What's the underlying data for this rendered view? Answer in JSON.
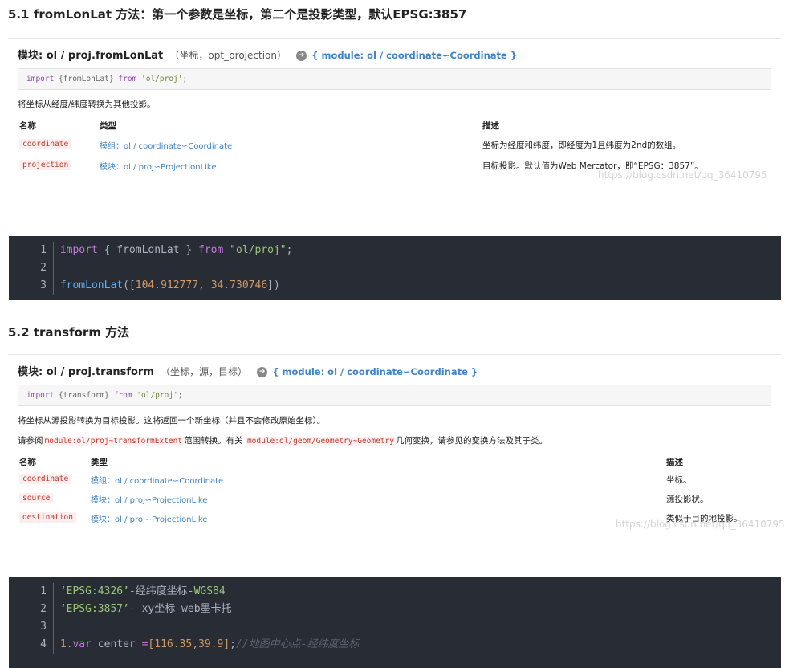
{
  "section1": {
    "heading": "5.1 fromLonLat 方法：第一个参数是坐标，第二个是投影类型，默认EPSG:3857",
    "module_label": "模块: ol / proj.fromLonLat",
    "signature": "（坐标，opt_projection）",
    "link_text": "{ module: ol / coordinate∽Coordinate }",
    "import_code": {
      "kw1": "import",
      "name": " {fromLonLat} ",
      "kw2": "from",
      "str": " 'ol/proj'",
      "end": ";"
    },
    "description": "将坐标从经度/纬度转换为其他投影。",
    "columns": {
      "name": "名称",
      "type": "类型",
      "desc": "描述"
    },
    "params": [
      {
        "name": "coordinate",
        "type": "模组：ol / coordinate∽Coordinate",
        "desc": "坐标为经度和纬度，即经度为1且纬度为2nd的数组。"
      },
      {
        "name": "projection",
        "type": "模块：ol / proj∽ProjectionLike",
        "desc": "目标投影。默认值为Web Mercator，即“EPSG：3857”。"
      }
    ],
    "watermark": "https://blog.csdn.net/qq_36410795"
  },
  "code1": {
    "lines": [
      {
        "n": "1",
        "a": "import",
        "b": " { fromLonLat } ",
        "c": "from",
        "d": " \"ol/proj\"",
        "e": ";"
      },
      {
        "n": "2"
      },
      {
        "n": "3",
        "f": "fromLonLat",
        "g": "([",
        "h": "104.912777",
        "i": ", ",
        "j": "34.730746",
        "k": "])"
      }
    ]
  },
  "section2": {
    "heading": "5.2 transform 方法",
    "module_label": "模块: ol / proj.transform",
    "signature": "（坐标，源，目标）",
    "link_text": "{ module: ol / coordinate∽Coordinate }",
    "import_code": {
      "kw1": "import",
      "name": " {transform} ",
      "kw2": "from",
      "str": " 'ol/proj'",
      "end": ";"
    },
    "description": "将坐标从源投影转换为目标投影。这将返回一个新坐标（并且不会修改原始坐标）。",
    "see_prefix": "请参阅",
    "see_code1": "module:ol/proj~transformExtent",
    "see_mid": "范围转换。有关",
    "see_code2": "module:ol/geom/Geometry~Geometry",
    "see_suffix": "几何变换，请参见的变换方法及其子类。",
    "columns": {
      "name": "名称",
      "type": "类型",
      "desc": "描述"
    },
    "params": [
      {
        "name": "coordinate",
        "type": "模组：ol / coordinate∽Coordinate",
        "desc": "坐标。"
      },
      {
        "name": "source",
        "type": "模块：ol / proj∽ProjectionLike",
        "desc": "源投影状。"
      },
      {
        "name": "destination",
        "type": "模块：ol / proj∽ProjectionLike",
        "desc": "类似于目的地投影。"
      }
    ],
    "watermark": "https://blog.csdn.net/qq_36410795"
  },
  "code2": {
    "lines": [
      {
        "n": "1",
        "a": "‘EPSG:4326’",
        "b": "-经纬度坐标-",
        "c": "WGS84"
      },
      {
        "n": "2",
        "a": "‘EPSG:3857’",
        "b": "- xy坐标-web墨卡托"
      },
      {
        "n": "3"
      },
      {
        "n": "4",
        "p": "1.",
        "q": "var",
        "r": " center ",
        "s": "=",
        "t": "[116.35,39.9]",
        "u": ";",
        "v": "//地图中心点-经纬度坐标"
      }
    ]
  }
}
